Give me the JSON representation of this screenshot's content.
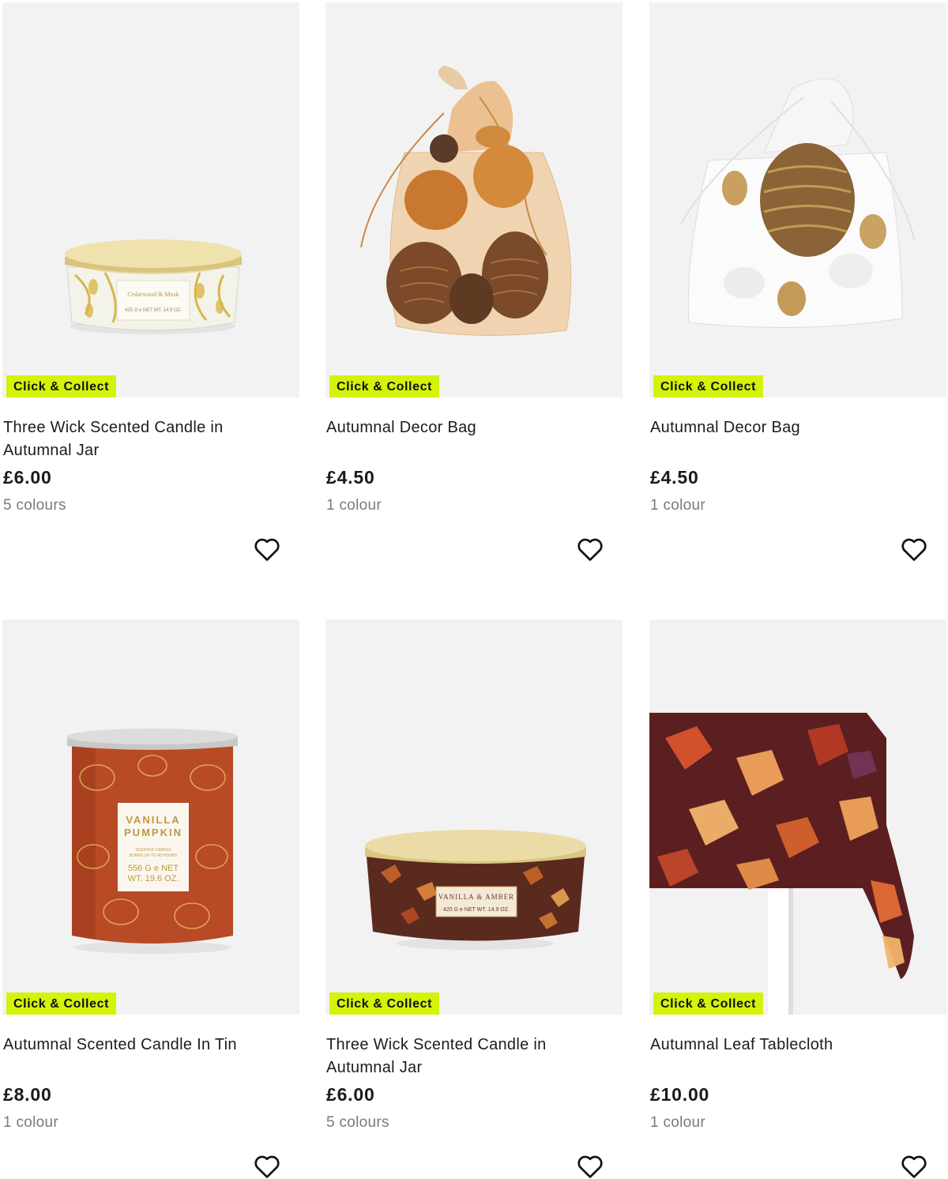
{
  "products": [
    {
      "badge": "Click & Collect",
      "title": "Three Wick Scented Candle in Autumnal Jar",
      "price": "£6.00",
      "colours": "5 colours",
      "image": "white-gold-leaf-candle-jar",
      "label": [
        "Cedarwood & Musk",
        "425 G e NET WT. 14.9 OZ."
      ]
    },
    {
      "badge": "Click & Collect",
      "title": "Autumnal Decor Bag",
      "price": "£4.50",
      "colours": "1 colour",
      "image": "orange-organza-bag-pinecones"
    },
    {
      "badge": "Click & Collect",
      "title": "Autumnal Decor Bag",
      "price": "£4.50",
      "colours": "1 colour",
      "image": "white-organza-bag-pinecones-gold-acorns"
    },
    {
      "badge": "Click & Collect",
      "title": "Autumnal Scented Candle In Tin",
      "price": "£8.00",
      "colours": "1 colour",
      "image": "orange-pumpkin-candle-tin",
      "label": [
        "VANILLA",
        "PUMPKIN",
        "SCENTED CANDLE",
        "BURNS UP TO 40 HOURS",
        "556 G e NET",
        "WT. 19.6 OZ."
      ]
    },
    {
      "badge": "Click & Collect",
      "title": "Three Wick Scented Candle in Autumnal Jar",
      "price": "£6.00",
      "colours": "5 colours",
      "image": "autumn-leaf-candle-jar",
      "label": [
        "VANILLA & AMBER",
        "425 G e NET WT. 14.9 OZ."
      ]
    },
    {
      "badge": "Click & Collect",
      "title": "Autumnal Leaf Tablecloth",
      "price": "£10.00",
      "colours": "1 colour",
      "image": "autumn-leaf-tablecloth"
    }
  ],
  "icons": {
    "wishlist": "heart-outline-icon"
  },
  "colors": {
    "badge_bg": "#d4f20a",
    "image_bg": "#f2f2f2",
    "muted_text": "#7a7a7a"
  }
}
